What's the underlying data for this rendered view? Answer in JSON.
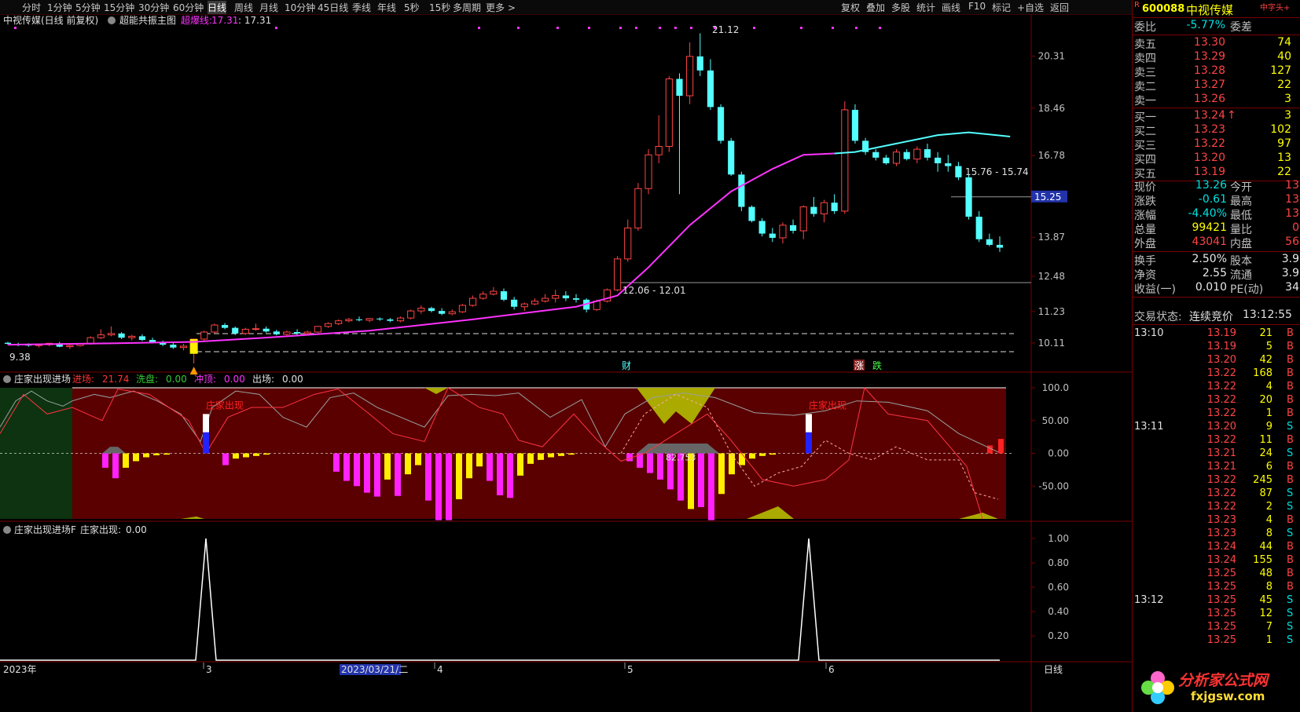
{
  "toolbar": {
    "timeframes": [
      "分时",
      "1分钟",
      "5分钟",
      "15分钟",
      "30分钟",
      "60分钟",
      "日线",
      "周线",
      "月线",
      "10分钟",
      "45日线",
      "季线",
      "年线",
      "5秒",
      "15秒",
      "多周期",
      "更多 >"
    ],
    "active": "日线",
    "buttons": [
      "复权",
      "叠加",
      "多股",
      "统计",
      "画线",
      "F10",
      "标记",
      "+自选",
      "返回"
    ]
  },
  "main_panel": {
    "stock_title": "中视传媒(日线 前复权)",
    "indicator_name": "超能共振主图",
    "indicator_line_label": "超爆线:",
    "indicator_line_value": "17.31",
    "indicator_line_value2": ": 17.31",
    "annotations": {
      "high": "21.12",
      "low": "9.38",
      "mid1": "12.06 - 12.01",
      "mid2": "15.76 - 15.74",
      "cai": "财",
      "zhang": "涨",
      "die": "跌"
    },
    "y_ticks": [
      "20.31",
      "18.46",
      "16.78",
      "15.26",
      "13.87",
      "12.48",
      "11.23",
      "10.11"
    ],
    "current_price_tag": "15.25"
  },
  "sub_panel1": {
    "title": "庄家出现进场",
    "items": [
      {
        "label": "进场:",
        "value": "21.74",
        "color": "#ff3333"
      },
      {
        "label": "洗盘:",
        "value": "0.00",
        "color": "#33cc33"
      },
      {
        "label": "冲顶:",
        "value": "0.00",
        "color": "#ff33ff"
      },
      {
        "label": "出场:",
        "value": "0.00",
        "color": "#e0e0e0"
      }
    ],
    "signal_text": "庄家出现",
    "center_value": "82.753",
    "y_ticks": [
      "100.0",
      "50.00",
      "0.00",
      "-50.00"
    ]
  },
  "sub_panel2": {
    "title": "庄家出现进场F",
    "label": "庄家出现:",
    "value": "0.00",
    "y_ticks": [
      "1.00",
      "0.80",
      "0.60",
      "0.40",
      "0.20"
    ]
  },
  "x_axis": {
    "labels": [
      "2023年",
      "3",
      "2023/03/21/二",
      "4",
      "5",
      "6"
    ],
    "period_label": "日线"
  },
  "quote_panel": {
    "badge": "R",
    "code": "600088",
    "name": "中视传媒",
    "tag": "中字头+",
    "weibi_label": "委比",
    "weibi": "-5.77%",
    "weicha_label": "委差",
    "asks": [
      {
        "label": "卖五",
        "price": "13.30",
        "vol": "74"
      },
      {
        "label": "卖四",
        "price": "13.29",
        "vol": "40"
      },
      {
        "label": "卖三",
        "price": "13.28",
        "vol": "127"
      },
      {
        "label": "卖二",
        "price": "13.27",
        "vol": "22"
      },
      {
        "label": "卖一",
        "price": "13.26",
        "vol": "3"
      }
    ],
    "bids": [
      {
        "label": "买一",
        "price": "13.24",
        "vol": "3",
        "arrow": "↑"
      },
      {
        "label": "买二",
        "price": "13.23",
        "vol": "102"
      },
      {
        "label": "买三",
        "price": "13.22",
        "vol": "97"
      },
      {
        "label": "买四",
        "price": "13.20",
        "vol": "13"
      },
      {
        "label": "买五",
        "price": "13.19",
        "vol": "22"
      }
    ],
    "stats": [
      {
        "l1": "现价",
        "v1": "13.26",
        "c1": "grn",
        "l2": "今开",
        "v2": "13"
      },
      {
        "l1": "涨跌",
        "v1": "-0.61",
        "c1": "grn",
        "l2": "最高",
        "v2": "13"
      },
      {
        "l1": "涨幅",
        "v1": "-4.40%",
        "c1": "grn",
        "l2": "最低",
        "v2": "13"
      },
      {
        "l1": "总量",
        "v1": "99421",
        "c1": "ylw",
        "l2": "量比",
        "v2": "0"
      },
      {
        "l1": "外盘",
        "v1": "43041",
        "c1": "red",
        "l2": "内盘",
        "v2": "56"
      }
    ],
    "stats2": [
      {
        "l1": "换手",
        "v1": "2.50%",
        "l2": "股本",
        "v2": "3.9"
      },
      {
        "l1": "净资",
        "v1": "2.55",
        "l2": "流通",
        "v2": "3.9"
      },
      {
        "l1": "收益(一)",
        "v1": "0.010",
        "l2": "PE(动)",
        "v2": "34"
      }
    ],
    "trade_status_label": "交易状态:",
    "trade_status": "连续竞价",
    "trade_time": "13:12:55",
    "ticks": [
      {
        "t": "13:10",
        "p": "13.19",
        "v": "21",
        "s": "B"
      },
      {
        "t": "",
        "p": "13.19",
        "v": "5",
        "s": "B"
      },
      {
        "t": "",
        "p": "13.20",
        "v": "42",
        "s": "B"
      },
      {
        "t": "",
        "p": "13.22",
        "v": "168",
        "s": "B"
      },
      {
        "t": "",
        "p": "13.22",
        "v": "4",
        "s": "B"
      },
      {
        "t": "",
        "p": "13.22",
        "v": "20",
        "s": "B"
      },
      {
        "t": "",
        "p": "13.22",
        "v": "1",
        "s": "B"
      },
      {
        "t": "13:11",
        "p": "13.20",
        "v": "9",
        "s": "S"
      },
      {
        "t": "",
        "p": "13.22",
        "v": "11",
        "s": "B"
      },
      {
        "t": "",
        "p": "13.21",
        "v": "24",
        "s": "S"
      },
      {
        "t": "",
        "p": "13.21",
        "v": "6",
        "s": "B"
      },
      {
        "t": "",
        "p": "13.22",
        "v": "245",
        "s": "B"
      },
      {
        "t": "",
        "p": "13.22",
        "v": "87",
        "s": "S"
      },
      {
        "t": "",
        "p": "13.22",
        "v": "2",
        "s": "S"
      },
      {
        "t": "",
        "p": "13.23",
        "v": "4",
        "s": "B"
      },
      {
        "t": "",
        "p": "13.23",
        "v": "8",
        "s": "S"
      },
      {
        "t": "",
        "p": "13.24",
        "v": "44",
        "s": "B"
      },
      {
        "t": "",
        "p": "13.24",
        "v": "155",
        "s": "B"
      },
      {
        "t": "",
        "p": "13.25",
        "v": "48",
        "s": "B"
      },
      {
        "t": "",
        "p": "13.25",
        "v": "8",
        "s": "B"
      },
      {
        "t": "13:12",
        "p": "13.25",
        "v": "45",
        "s": "S"
      },
      {
        "t": "",
        "p": "13.25",
        "v": "12",
        "s": "S"
      },
      {
        "t": "",
        "p": "13.25",
        "v": "7",
        "s": "S"
      },
      {
        "t": "",
        "p": "13.25",
        "v": "1",
        "s": "S"
      }
    ],
    "watermark_cn": "分析家公式网",
    "watermark_url": "fxjgsw.com"
  },
  "colors": {
    "up": "#ff4444",
    "down": "#54ffff",
    "ma_line": "#ff33ff",
    "ma_line_tail": "#54ffff",
    "panel_bg": "#5a0000",
    "panel_bg_green": "#0d3310",
    "bar_magenta": "#ff22ff",
    "bar_yellow": "#ffee00"
  },
  "chart_data": {
    "type": "candlestick",
    "candles": [
      [
        10.12,
        10.15,
        10.05,
        10.08
      ],
      [
        10.08,
        10.12,
        10.0,
        10.05
      ],
      [
        10.05,
        10.1,
        9.98,
        10.02
      ],
      [
        10.02,
        10.08,
        9.95,
        10.05
      ],
      [
        10.05,
        10.12,
        10.0,
        10.1
      ],
      [
        10.1,
        10.15,
        9.96,
        9.98
      ],
      [
        9.98,
        10.05,
        9.9,
        10.02
      ],
      [
        10.02,
        10.1,
        9.98,
        10.08
      ],
      [
        10.08,
        10.35,
        10.05,
        10.3
      ],
      [
        10.3,
        10.6,
        10.25,
        10.4
      ],
      [
        10.4,
        10.7,
        10.35,
        10.45
      ],
      [
        10.45,
        10.5,
        10.25,
        10.3
      ],
      [
        10.3,
        10.4,
        10.2,
        10.35
      ],
      [
        10.35,
        10.42,
        10.18,
        10.22
      ],
      [
        10.22,
        10.3,
        10.1,
        10.15
      ],
      [
        10.15,
        10.2,
        10.0,
        10.05
      ],
      [
        10.05,
        10.12,
        9.9,
        9.95
      ],
      [
        9.95,
        10.08,
        9.85,
        10.0
      ],
      [
        10.0,
        10.2,
        9.38,
        10.25
      ],
      [
        10.25,
        10.55,
        10.2,
        10.5
      ],
      [
        10.5,
        10.8,
        10.45,
        10.75
      ],
      [
        10.75,
        10.82,
        10.6,
        10.65
      ],
      [
        10.65,
        10.7,
        10.4,
        10.45
      ],
      [
        10.45,
        10.65,
        10.4,
        10.6
      ],
      [
        10.6,
        10.8,
        10.55,
        10.62
      ],
      [
        10.62,
        10.7,
        10.48,
        10.52
      ],
      [
        10.52,
        10.58,
        10.38,
        10.42
      ],
      [
        10.42,
        10.55,
        10.38,
        10.5
      ],
      [
        10.5,
        10.6,
        10.4,
        10.45
      ],
      [
        10.45,
        10.55,
        10.38,
        10.5
      ],
      [
        10.5,
        10.72,
        10.48,
        10.7
      ],
      [
        10.7,
        10.85,
        10.65,
        10.8
      ],
      [
        10.8,
        10.95,
        10.75,
        10.9
      ],
      [
        10.9,
        11.0,
        10.85,
        10.95
      ],
      [
        10.95,
        11.05,
        10.88,
        10.92
      ],
      [
        10.92,
        11.0,
        10.85,
        10.98
      ],
      [
        10.98,
        11.02,
        10.9,
        10.95
      ],
      [
        10.95,
        11.0,
        10.85,
        10.9
      ],
      [
        10.9,
        11.05,
        10.85,
        11.0
      ],
      [
        11.0,
        11.3,
        10.95,
        11.25
      ],
      [
        11.25,
        11.45,
        11.15,
        11.35
      ],
      [
        11.35,
        11.4,
        11.2,
        11.25
      ],
      [
        11.25,
        11.35,
        11.1,
        11.15
      ],
      [
        11.15,
        11.3,
        11.1,
        11.22
      ],
      [
        11.22,
        11.5,
        11.18,
        11.45
      ],
      [
        11.45,
        11.8,
        11.4,
        11.7
      ],
      [
        11.7,
        11.95,
        11.65,
        11.85
      ],
      [
        11.85,
        12.1,
        11.8,
        11.95
      ],
      [
        11.95,
        12.05,
        11.6,
        11.65
      ],
      [
        11.65,
        11.75,
        11.3,
        11.4
      ],
      [
        11.4,
        11.55,
        11.25,
        11.5
      ],
      [
        11.5,
        11.7,
        11.45,
        11.6
      ],
      [
        11.6,
        11.85,
        11.55,
        11.7
      ],
      [
        11.7,
        12.0,
        11.55,
        11.8
      ],
      [
        11.8,
        11.95,
        11.6,
        11.7
      ],
      [
        11.7,
        11.85,
        11.55,
        11.65
      ],
      [
        11.65,
        11.7,
        11.2,
        11.3
      ],
      [
        11.3,
        11.65,
        11.25,
        11.6
      ],
      [
        11.6,
        12.05,
        11.55,
        12.0
      ],
      [
        12.0,
        13.2,
        11.95,
        13.1
      ],
      [
        13.1,
        14.5,
        13.0,
        14.2
      ],
      [
        14.2,
        15.8,
        14.1,
        15.6
      ],
      [
        15.6,
        17.0,
        15.4,
        16.8
      ],
      [
        16.8,
        18.2,
        16.5,
        17.1
      ],
      [
        17.1,
        19.6,
        16.9,
        19.5
      ],
      [
        19.5,
        19.7,
        15.4,
        18.9
      ],
      [
        18.9,
        20.8,
        18.6,
        20.3
      ],
      [
        20.3,
        21.12,
        19.6,
        19.8
      ],
      [
        19.8,
        20.2,
        18.4,
        18.5
      ],
      [
        18.5,
        18.6,
        17.2,
        17.3
      ],
      [
        17.3,
        17.4,
        16.05,
        16.1
      ],
      [
        16.1,
        16.2,
        14.8,
        14.95
      ],
      [
        14.95,
        15.0,
        14.4,
        14.45
      ],
      [
        14.45,
        14.55,
        13.9,
        14.0
      ],
      [
        14.0,
        14.2,
        13.7,
        13.85
      ],
      [
        13.85,
        14.4,
        13.65,
        14.3
      ],
      [
        14.3,
        14.5,
        14.0,
        14.1
      ],
      [
        14.1,
        15.0,
        13.8,
        14.95
      ],
      [
        14.95,
        15.3,
        14.6,
        14.7
      ],
      [
        14.7,
        15.2,
        14.4,
        15.1
      ],
      [
        15.1,
        15.4,
        14.7,
        14.8
      ],
      [
        14.8,
        18.7,
        14.7,
        18.4
      ],
      [
        18.4,
        18.6,
        17.2,
        17.3
      ],
      [
        17.3,
        17.4,
        16.8,
        16.9
      ],
      [
        16.9,
        17.0,
        16.6,
        16.7
      ],
      [
        16.7,
        16.8,
        16.45,
        16.5
      ],
      [
        16.5,
        17.0,
        16.4,
        16.9
      ],
      [
        16.9,
        17.0,
        16.6,
        16.65
      ],
      [
        16.65,
        17.1,
        16.5,
        17.0
      ],
      [
        17.0,
        17.2,
        16.6,
        16.7
      ],
      [
        16.7,
        16.9,
        16.2,
        16.5
      ],
      [
        16.5,
        16.8,
        16.2,
        16.4
      ],
      [
        16.4,
        16.55,
        15.9,
        16.0
      ],
      [
        16.0,
        16.1,
        14.5,
        14.6
      ],
      [
        14.6,
        14.8,
        13.7,
        13.8
      ],
      [
        13.8,
        14.0,
        13.55,
        13.6
      ],
      [
        13.6,
        13.9,
        13.35,
        13.5
      ]
    ],
    "ma_line": [
      [
        0,
        10.05
      ],
      [
        10,
        10.1
      ],
      [
        18,
        10.15
      ],
      [
        25,
        10.3
      ],
      [
        35,
        10.55
      ],
      [
        45,
        10.95
      ],
      [
        55,
        11.4
      ],
      [
        59,
        11.8
      ],
      [
        62,
        12.8
      ],
      [
        66,
        14.3
      ],
      [
        70,
        15.5
      ],
      [
        74,
        16.3
      ],
      [
        77,
        16.8
      ],
      [
        80,
        16.85
      ],
      [
        82,
        16.9
      ],
      [
        86,
        17.2
      ],
      [
        90,
        17.5
      ],
      [
        93,
        17.6
      ],
      [
        97,
        17.45
      ]
    ],
    "ylim": [
      9.3,
      21.3
    ]
  }
}
